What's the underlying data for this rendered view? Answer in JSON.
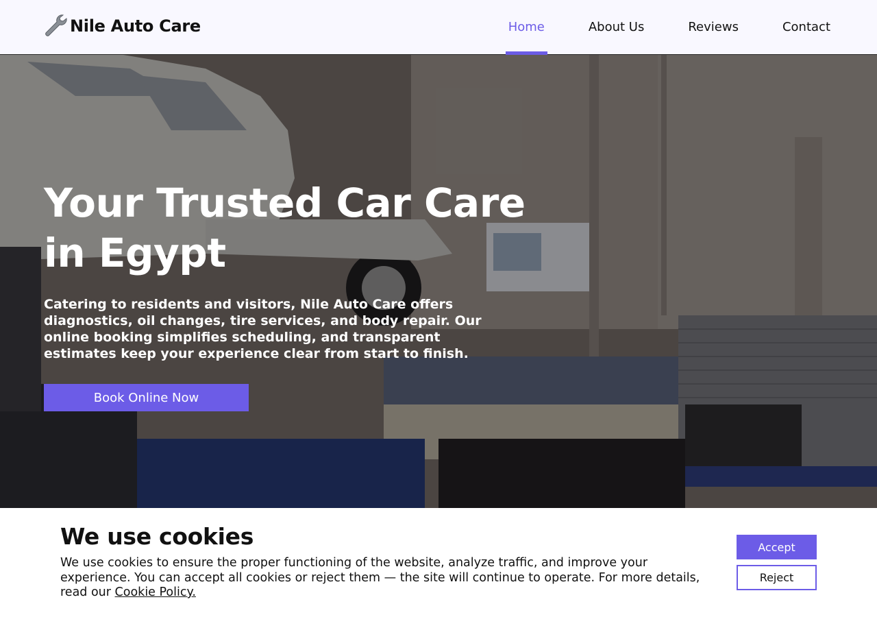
{
  "header": {
    "logo_icon": "wrench-icon",
    "logo_text": "Nile Auto Care",
    "nav": [
      {
        "label": "Home",
        "active": true
      },
      {
        "label": "About Us",
        "active": false
      },
      {
        "label": "Reviews",
        "active": false
      },
      {
        "label": "Contact",
        "active": false
      }
    ]
  },
  "hero": {
    "title": "Your Trusted Car Care in Egypt",
    "text": "Catering to residents and visitors, Nile Auto Care offers diagnostics, oil changes, tire services, and body repair. Our online booking simplifies scheduling, and transparent estimates keep your experience clear from start to finish.",
    "cta_label": "Book Online Now"
  },
  "cookie_banner": {
    "title": "We use cookies",
    "text": "We use cookies to ensure the proper functioning of the website, analyze traffic, and improve your experience. You can accept all cookies or reject them — the site will continue to operate. For more details, read our",
    "link_label": "Cookie Policy.",
    "accept_label": "Accept",
    "reject_label": "Reject"
  },
  "colors": {
    "accent": "#6c5ce7",
    "header_bg": "#f9f8ff",
    "text": "#111111"
  }
}
